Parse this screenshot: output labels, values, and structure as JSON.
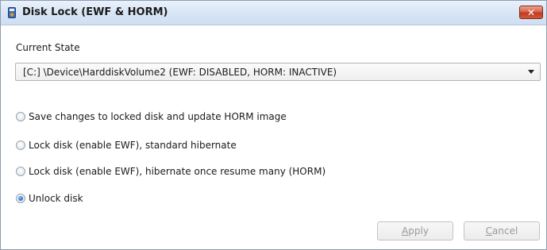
{
  "window": {
    "title": "Disk Lock (EWF & HORM)",
    "close_glyph": "✕"
  },
  "current_state": {
    "label": "Current State",
    "selected": "[C:] \\Device\\HarddiskVolume2 (EWF: DISABLED, HORM: INACTIVE)"
  },
  "options": [
    {
      "label": "Save changes to locked disk and update HORM image",
      "selected": false
    },
    {
      "label": "Lock disk (enable EWF), standard hibernate",
      "selected": false
    },
    {
      "label": "Lock disk (enable EWF), hibernate once resume many (HORM)",
      "selected": false
    },
    {
      "label": "Unlock disk",
      "selected": true
    }
  ],
  "buttons": {
    "apply_first": "A",
    "apply_rest": "pply",
    "cancel_first": "C",
    "cancel_rest": "ancel"
  },
  "colors": {
    "accent": "#1f6fd0",
    "close_red": "#c0391f",
    "disabled_text": "#9a9a9a"
  },
  "icons": {
    "app": "disk-lock-app-icon",
    "close": "close-icon",
    "dropdown": "chevron-down-icon"
  }
}
